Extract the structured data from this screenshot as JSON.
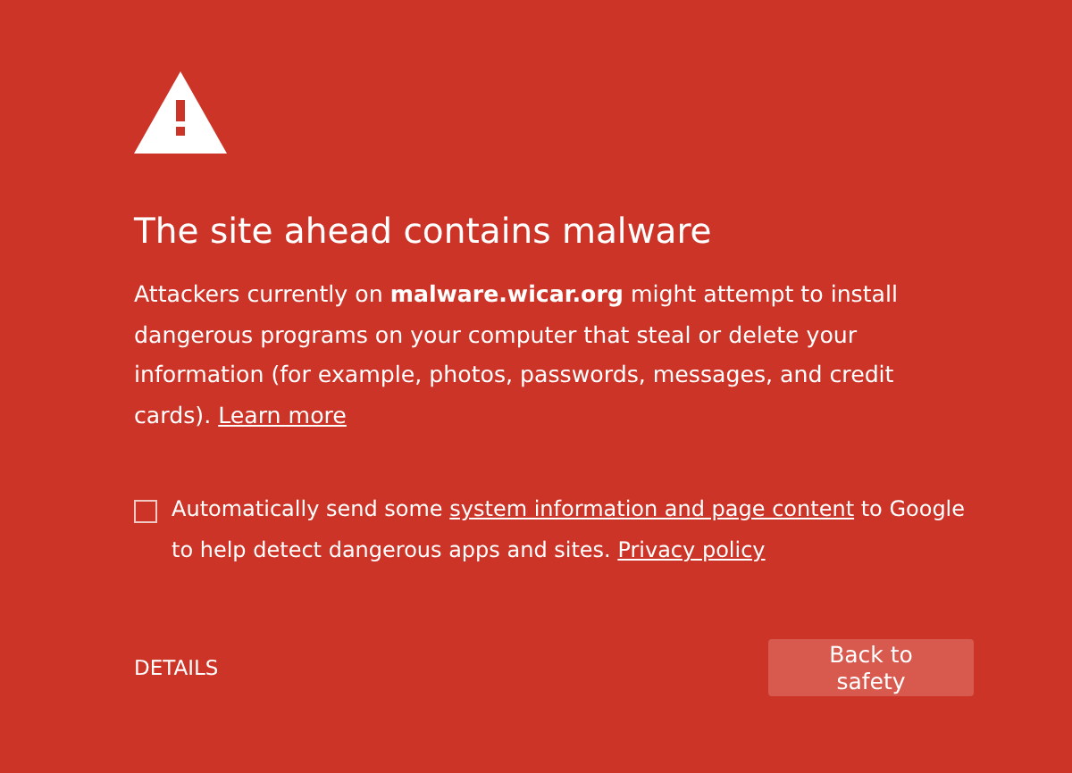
{
  "heading": "The site ahead contains malware",
  "message": {
    "text": "Attackers currently on **malware.wicar.org** might attempt to install dangerous programs on your computer that steal or delete your information (for example, photos, passwords, messages, and credit cards).",
    "link": "Learn more"
  },
  "report": {
    "checked": false,
    "text_before": "Automatically send some",
    "link": "system information and page content",
    "text_after": "to Google to help detect dangerous apps and sites.",
    "policy_link": "Privacy policy"
  },
  "details_button": "DETAILS",
  "safety_button": "Back to safety"
}
